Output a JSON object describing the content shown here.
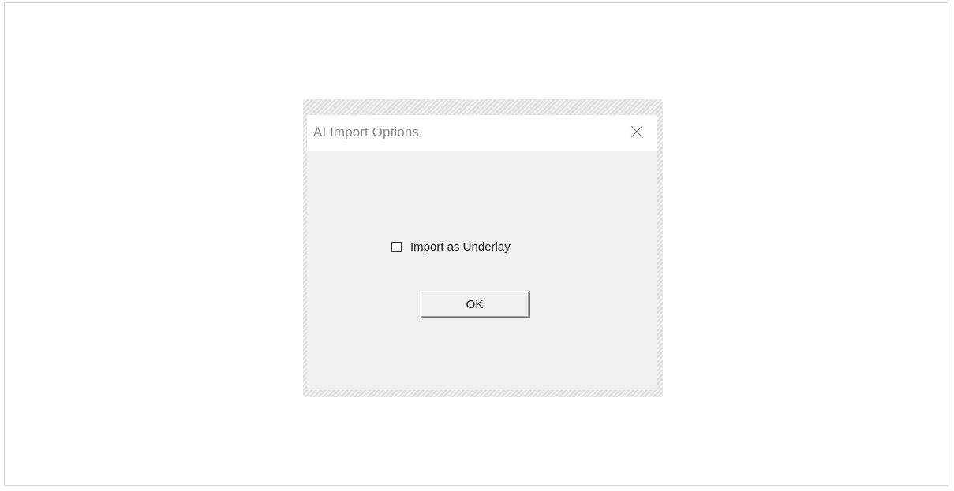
{
  "dialog": {
    "title": "AI Import Options",
    "close_icon": "close-icon",
    "checkbox": {
      "label": "Import as Underlay",
      "checked": false
    },
    "ok_label": "OK"
  },
  "colors": {
    "dialog_bg": "#f0f0f0",
    "titlebar_bg": "#ffffff",
    "title_text": "#8a8a8a"
  }
}
